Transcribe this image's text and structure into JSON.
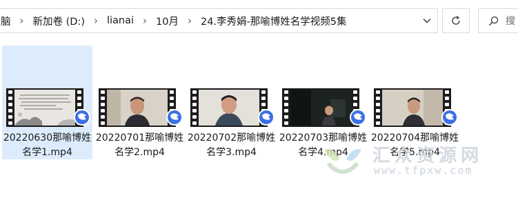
{
  "address_bar": {
    "crumbs": [
      "脑",
      "新加卷 (D:)",
      "lianai",
      "10月",
      "24.李秀娟-那喻博姓名学视频5集"
    ]
  },
  "colors": {
    "selection": "#dcecfc",
    "border": "#d9d9d9",
    "accent_badge": "#3c6fe6"
  },
  "icons": {
    "separator": "chevron-right-icon",
    "dropdown": "chevron-down-icon",
    "refresh": "refresh-icon",
    "search": "search-icon",
    "badge": "media-player-icon"
  },
  "files": [
    {
      "name": "20220630那喻博姓名学1.mp4",
      "selected": true,
      "thumb": "calligraphy"
    },
    {
      "name": "20220701那喻博姓名学2.mp4",
      "selected": false,
      "thumb": "person"
    },
    {
      "name": "20220702那喻博姓名学3.mp4",
      "selected": false,
      "thumb": "person"
    },
    {
      "name": "20220703那喻博姓名学4.mp4",
      "selected": false,
      "thumb": "person-dark"
    },
    {
      "name": "20220704那喻博姓名学5.mp4",
      "selected": false,
      "thumb": "person"
    }
  ],
  "watermark": {
    "title": "汇众资源网",
    "url": "www.tfpxw.com"
  }
}
